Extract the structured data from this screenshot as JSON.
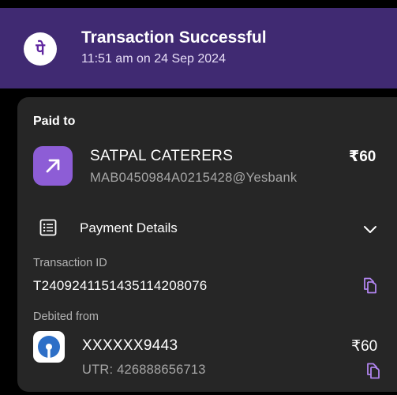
{
  "header": {
    "logo": "phonepe-logo-icon",
    "title": "Transaction Successful",
    "subtitle": "11:51 am on 24 Sep 2024"
  },
  "paid_to": {
    "label": "Paid to",
    "icon": "arrow-up-right-icon",
    "name": "SATPAL CATERERS",
    "vpa": "MAB0450984A0215428@Yesbank",
    "amount": "₹60"
  },
  "payment_details": {
    "icon": "list-icon",
    "label": "Payment Details",
    "chevron": "chevron-down-icon"
  },
  "transaction": {
    "id_label": "Transaction ID",
    "id_value": "T2409241151435114208076",
    "copy_icon": "copy-icon"
  },
  "debited": {
    "label": "Debited from",
    "bank_icon": "sbi-logo-icon",
    "account": "XXXXXX9443",
    "utr": "UTR: 426888656713",
    "amount": "₹60",
    "copy_icon": "copy-icon"
  },
  "colors": {
    "header_bg": "#402a72",
    "card_bg": "#262626",
    "accent": "#8d5dd6",
    "page_bg": "#000000"
  }
}
